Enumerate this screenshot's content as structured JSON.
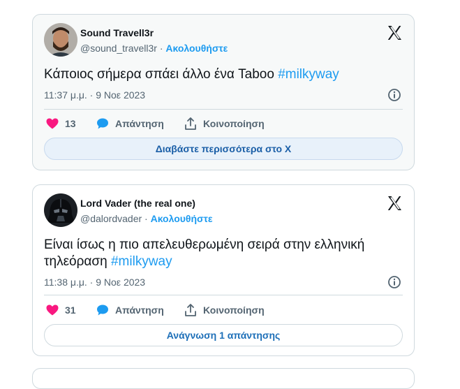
{
  "tweets": [
    {
      "name": "Sound Travell3r",
      "handle": "@sound_travell3r",
      "separator": "·",
      "follow": "Ακολουθήστε",
      "text": "Κάποιος σήμερα σπάει άλλο ένα Taboo ",
      "hashtag": "#milkyway",
      "date": "11:37 μ.μ. · 9 Νοε 2023",
      "likes": "13",
      "reply": "Απάντηση",
      "share": "Κοινοποίηση",
      "button": "Διαβάστε περισσότερα στο X"
    },
    {
      "name": "Lord Vader (the real one)",
      "handle": "@dalordvader",
      "separator": "·",
      "follow": "Ακολουθήστε",
      "text": "Είναι ίσως η πιο απελευθερωμένη σειρά στην ελληνική τηλεόραση ",
      "hashtag": "#milkyway",
      "date": "11:38 μ.μ. · 9 Νοε 2023",
      "likes": "31",
      "reply": "Απάντηση",
      "share": "Κοινοποίηση",
      "button": "Ανάγνωση 1 απάντησης"
    }
  ],
  "colors": {
    "accent": "#1d9bf0",
    "heart": "#f91880",
    "muted": "#536471"
  }
}
